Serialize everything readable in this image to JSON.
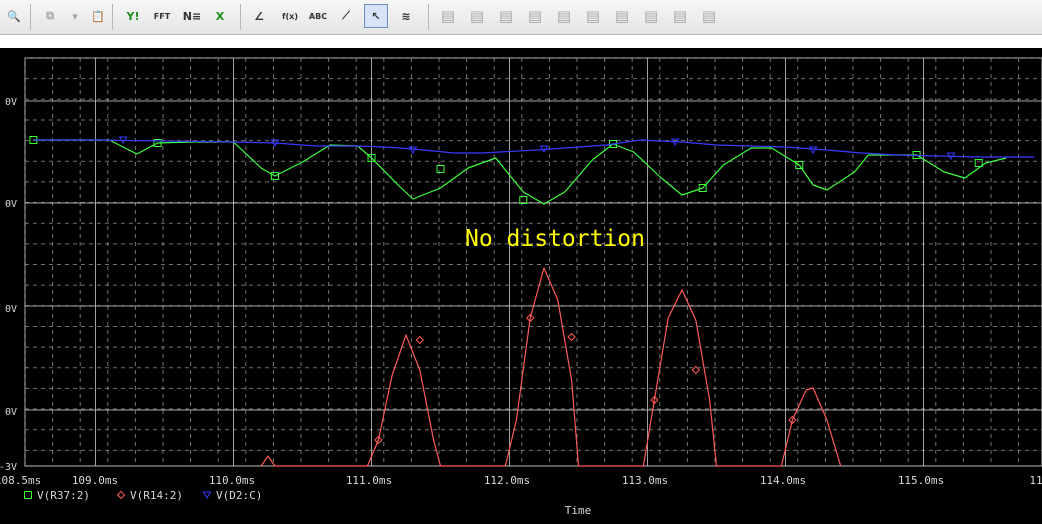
{
  "toolbar": {
    "buttons": [
      {
        "name": "zoom-icon",
        "glyph": "🔍",
        "enabled": true
      },
      {
        "name": "copy-plot-icon",
        "glyph": "⧉",
        "enabled": false
      },
      {
        "name": "dropdown-icon",
        "glyph": "▾",
        "enabled": false
      },
      {
        "name": "clipboard-icon",
        "glyph": "📋",
        "enabled": false
      },
      {
        "name": "y-axis-icon",
        "glyph": "Y!",
        "enabled": true
      },
      {
        "name": "fft-icon",
        "glyph": "FFT",
        "enabled": true
      },
      {
        "name": "performance-analysis-icon",
        "glyph": "N≡",
        "enabled": true
      },
      {
        "name": "excel-icon",
        "glyph": "X",
        "enabled": true
      },
      {
        "name": "add-trace-icon",
        "glyph": "∠",
        "enabled": true
      },
      {
        "name": "eval-goal-function-icon",
        "glyph": "f(x)",
        "enabled": true
      },
      {
        "name": "text-label-icon",
        "glyph": "ABC",
        "enabled": true
      },
      {
        "name": "mark-label-icon",
        "glyph": "⟋",
        "enabled": true
      },
      {
        "name": "select-pointer-icon",
        "glyph": "↖",
        "enabled": true,
        "active": true
      },
      {
        "name": "noise-icon",
        "glyph": "≋",
        "enabled": true
      },
      {
        "name": "cursor-peak-icon",
        "glyph": "▤",
        "enabled": false
      },
      {
        "name": "cursor-trough-icon",
        "glyph": "▤",
        "enabled": false
      },
      {
        "name": "cursor-slope-icon",
        "glyph": "▤",
        "enabled": false
      },
      {
        "name": "cursor-min-icon",
        "glyph": "▤",
        "enabled": false
      },
      {
        "name": "cursor-max-icon",
        "glyph": "▤",
        "enabled": false
      },
      {
        "name": "cursor-point-icon",
        "glyph": "▤",
        "enabled": false
      },
      {
        "name": "cursor-search-icon",
        "glyph": "▤",
        "enabled": false
      },
      {
        "name": "cursor-next-icon",
        "glyph": "▤",
        "enabled": false
      },
      {
        "name": "cursor-prev-icon",
        "glyph": "▤",
        "enabled": false
      },
      {
        "name": "cursor-mark-icon",
        "glyph": "▤",
        "enabled": false
      }
    ]
  },
  "colors": {
    "background": "#000000",
    "grid": "#9a9a9a",
    "axis_text": "#d8d8d8",
    "green": "#3cff3c",
    "red": "#ff5a5a",
    "blue": "#3a3aff",
    "annotation": "#ffff00"
  },
  "annotation": "No distortion",
  "chart_data": {
    "type": "line",
    "xlabel": "Time",
    "x_ticks": [
      "108.5ms",
      "109.0ms",
      "110.0ms",
      "111.0ms",
      "112.0ms",
      "113.0ms",
      "114.0ms",
      "115.0ms",
      "11"
    ],
    "y_ticks": [
      "0V",
      "0V",
      "0V",
      "0V",
      "-3V"
    ],
    "xlim": [
      108.5,
      115.8
    ],
    "grid": true,
    "legend_position": "bottom-left",
    "series": [
      {
        "name": "V(R37:2)",
        "marker": "square",
        "color": "#3cff3c",
        "points": [
          [
            108.55,
            140
          ],
          [
            108.8,
            140
          ],
          [
            109.1,
            140
          ],
          [
            109.3,
            154
          ],
          [
            109.45,
            143
          ],
          [
            109.7,
            142
          ],
          [
            110.0,
            142
          ],
          [
            110.2,
            168
          ],
          [
            110.3,
            176
          ],
          [
            110.5,
            162
          ],
          [
            110.7,
            145
          ],
          [
            110.9,
            146
          ],
          [
            111.0,
            158
          ],
          [
            111.2,
            186
          ],
          [
            111.3,
            199
          ],
          [
            111.5,
            188
          ],
          [
            111.7,
            168
          ],
          [
            111.9,
            158
          ],
          [
            112.1,
            192
          ],
          [
            112.25,
            204
          ],
          [
            112.4,
            192
          ],
          [
            112.6,
            160
          ],
          [
            112.75,
            144
          ],
          [
            112.9,
            152
          ],
          [
            113.1,
            178
          ],
          [
            113.25,
            195
          ],
          [
            113.4,
            188
          ],
          [
            113.55,
            165
          ],
          [
            113.75,
            148
          ],
          [
            113.9,
            148
          ],
          [
            114.1,
            165
          ],
          [
            114.2,
            185
          ],
          [
            114.3,
            190
          ],
          [
            114.5,
            172
          ],
          [
            114.6,
            155
          ],
          [
            114.8,
            155
          ],
          [
            114.95,
            155
          ],
          [
            115.15,
            172
          ],
          [
            115.3,
            178
          ],
          [
            115.45,
            163
          ],
          [
            115.6,
            158
          ]
        ]
      },
      {
        "name": "V(R14:2)",
        "marker": "diamond",
        "color": "#ff5a5a",
        "points": [
          [
            110.2,
            466
          ],
          [
            110.25,
            456
          ],
          [
            110.3,
            466
          ],
          [
            110.97,
            466
          ],
          [
            111.05,
            440
          ],
          [
            111.15,
            375
          ],
          [
            111.25,
            335
          ],
          [
            111.35,
            370
          ],
          [
            111.45,
            440
          ],
          [
            111.5,
            466
          ],
          [
            111.97,
            466
          ],
          [
            112.05,
            420
          ],
          [
            112.15,
            318
          ],
          [
            112.25,
            268
          ],
          [
            112.35,
            300
          ],
          [
            112.45,
            380
          ],
          [
            112.5,
            466
          ],
          [
            112.97,
            466
          ],
          [
            113.05,
            400
          ],
          [
            113.15,
            318
          ],
          [
            113.25,
            290
          ],
          [
            113.35,
            320
          ],
          [
            113.45,
            400
          ],
          [
            113.5,
            466
          ],
          [
            113.97,
            466
          ],
          [
            114.05,
            420
          ],
          [
            114.15,
            390
          ],
          [
            114.2,
            388
          ],
          [
            114.3,
            420
          ],
          [
            114.4,
            466
          ]
        ]
      },
      {
        "name": "V(D2:C)",
        "marker": "triangle-down",
        "color": "#3a3aff",
        "points": [
          [
            108.55,
            140
          ],
          [
            109.0,
            140
          ],
          [
            110.0,
            142
          ],
          [
            110.3,
            143
          ],
          [
            110.6,
            146
          ],
          [
            110.9,
            146
          ],
          [
            111.1,
            147
          ],
          [
            111.3,
            149
          ],
          [
            111.6,
            153
          ],
          [
            111.8,
            153
          ],
          [
            112.2,
            150
          ],
          [
            112.4,
            148
          ],
          [
            112.7,
            145
          ],
          [
            112.95,
            140
          ],
          [
            113.25,
            142
          ],
          [
            113.5,
            145
          ],
          [
            114.0,
            147
          ],
          [
            114.3,
            150
          ],
          [
            114.55,
            153
          ],
          [
            114.8,
            155
          ],
          [
            115.1,
            156
          ],
          [
            115.4,
            157
          ],
          [
            115.8,
            157
          ]
        ]
      }
    ]
  }
}
